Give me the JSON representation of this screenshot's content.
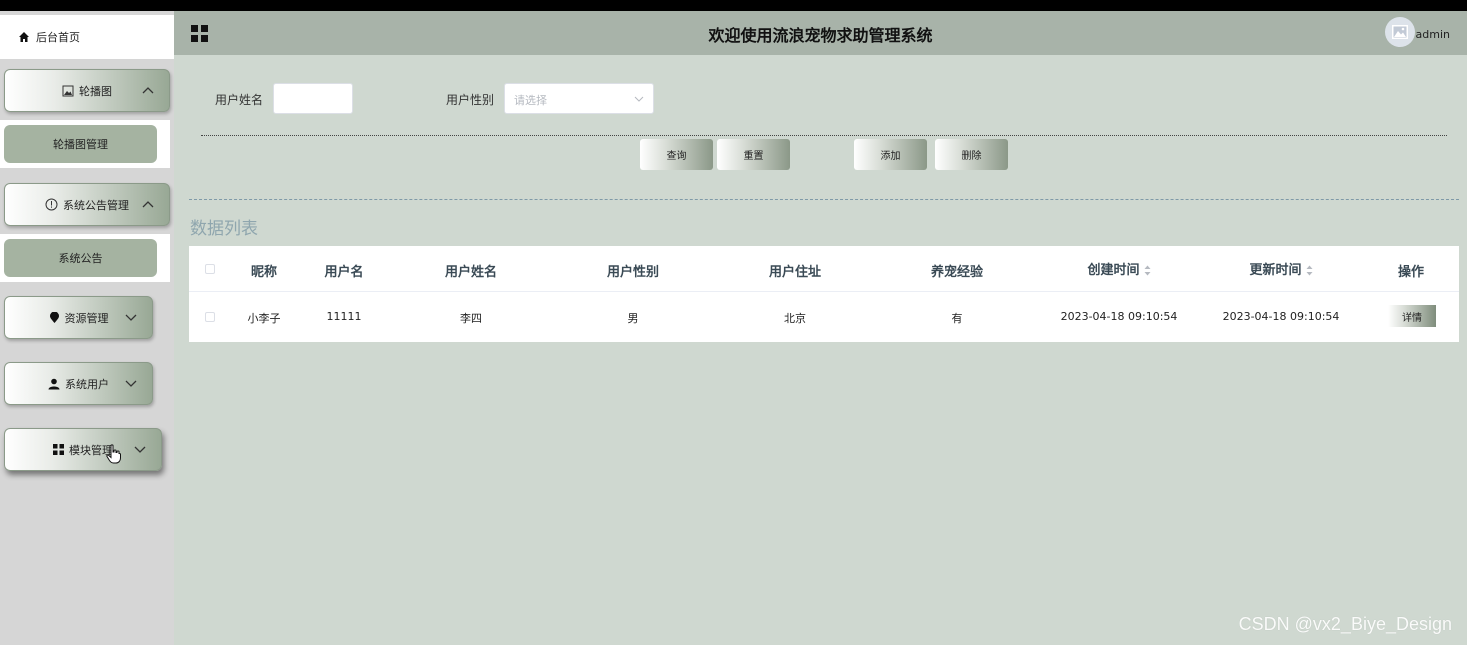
{
  "sidebar": {
    "home_label": "后台首页",
    "menus": [
      {
        "label": "轮播图",
        "icon": "image-icon",
        "expanded": true,
        "children": [
          "轮播图管理"
        ]
      },
      {
        "label": "系统公告管理",
        "icon": "info-circle-icon",
        "expanded": true,
        "children": [
          "系统公告"
        ]
      },
      {
        "label": "资源管理",
        "icon": "location-pin-icon",
        "expanded": false
      },
      {
        "label": "系统用户",
        "icon": "user-icon",
        "expanded": false
      },
      {
        "label": "模块管理",
        "icon": "grid-icon",
        "expanded": false
      }
    ]
  },
  "header": {
    "title": "欢迎使用流浪宠物求助管理系统",
    "username": "admin"
  },
  "search": {
    "name_label": "用户姓名",
    "name_value": "",
    "gender_label": "用户性别",
    "gender_placeholder": "请选择"
  },
  "actions": {
    "query": "查询",
    "reset": "重置",
    "add": "添加",
    "delete": "删除"
  },
  "list": {
    "title": "数据列表",
    "columns": [
      "昵称",
      "用户名",
      "用户姓名",
      "用户性别",
      "用户住址",
      "养宠经验",
      "创建时间",
      "更新时间",
      "操作"
    ],
    "rows": [
      {
        "nickname": "小李子",
        "username": "11111",
        "name": "李四",
        "gender": "男",
        "address": "北京",
        "experience": "有",
        "created": "2023-04-18 09:10:54",
        "updated": "2023-04-18 09:10:54",
        "action": "详情"
      }
    ]
  },
  "watermark": "CSDN @vx2_Biye_Design",
  "colors": {
    "header_bg": "#a8b3a9",
    "page_bg": "#cfd8d0",
    "sidebar_bg": "#d6d6d6",
    "submenu_bg": "#a5b3a1"
  }
}
